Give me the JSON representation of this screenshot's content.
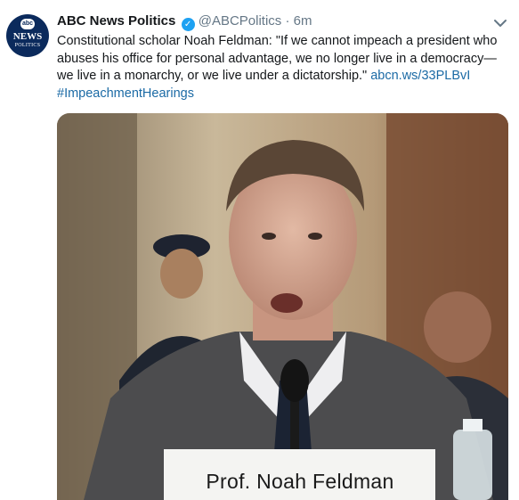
{
  "tweet": {
    "avatar": {
      "line1": "abc",
      "line2": "NEWS",
      "line3": "POLITICS"
    },
    "author_name": "ABC News Politics",
    "verified_icon": "verified-badge-icon",
    "handle": "@ABCPolitics",
    "separator": "·",
    "time": "6m",
    "menu_icon": "chevron-down-icon",
    "body_text": "Constitutional scholar Noah Feldman: \"If we cannot impeach a president who abuses his office for personal advantage, we no longer live in a democracy—we live in a monarchy, or we live under a dictatorship.\" ",
    "link_text": "abcn.ws/33PLBvI",
    "hashtag": "#ImpeachmentHearings",
    "media": {
      "placard_text": "Prof. Noah Feldman"
    }
  },
  "colors": {
    "link": "#1b6aa5",
    "verified": "#1da1f2",
    "muted": "#657786",
    "text": "#14171a"
  }
}
